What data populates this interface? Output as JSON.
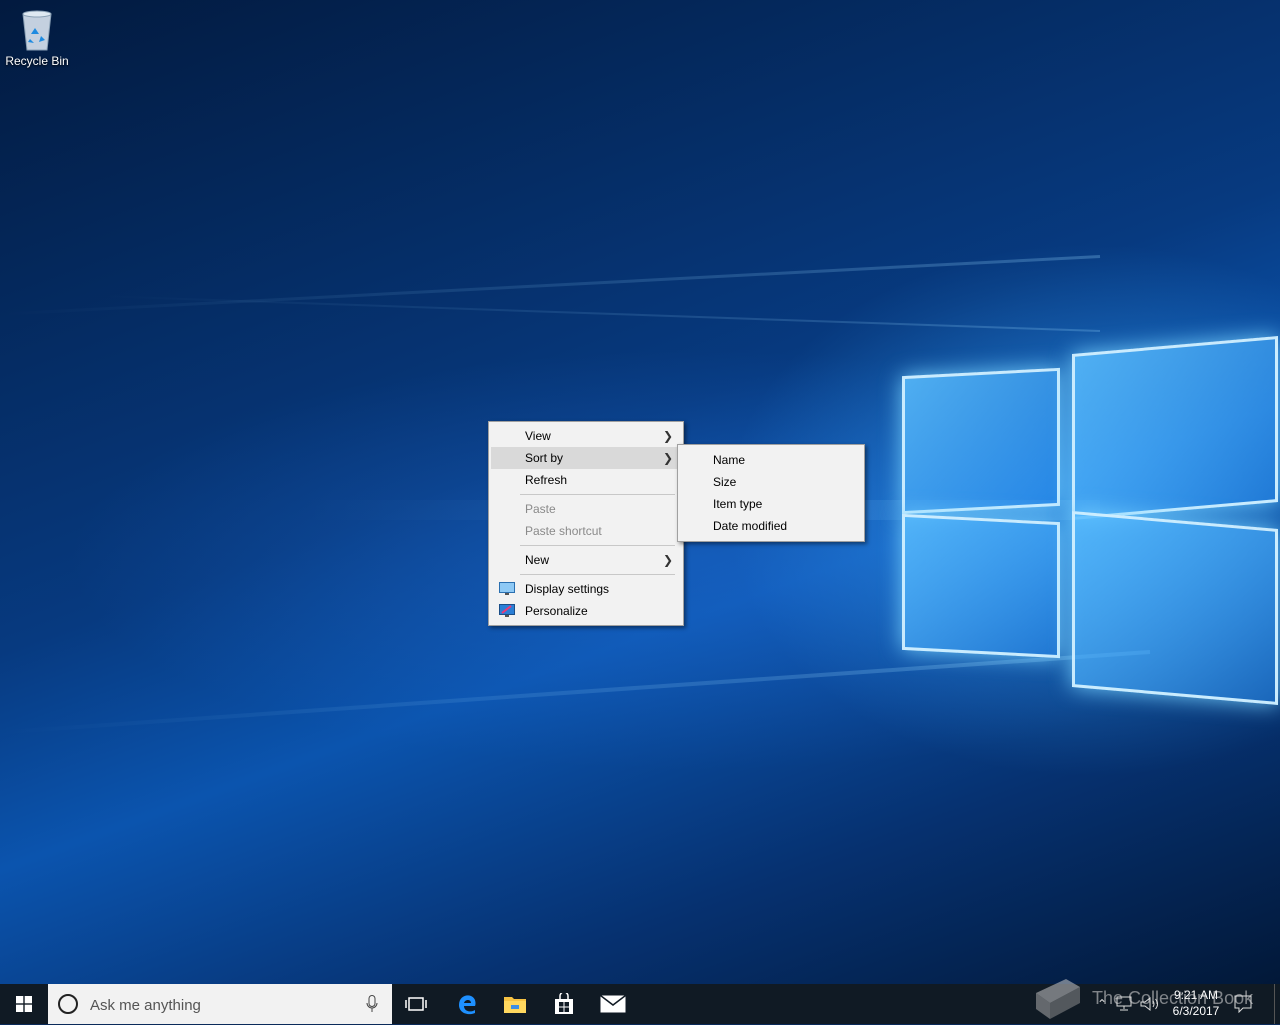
{
  "desktop": {
    "icons": [
      {
        "label": "Recycle Bin",
        "icon": "recycle-bin-icon"
      }
    ]
  },
  "context_menu": {
    "items": [
      {
        "label": "View",
        "has_submenu": true
      },
      {
        "label": "Sort by",
        "has_submenu": true,
        "highlighted": true
      },
      {
        "label": "Refresh"
      },
      {
        "label": "Paste",
        "disabled": true
      },
      {
        "label": "Paste shortcut",
        "disabled": true
      },
      {
        "label": "New",
        "has_submenu": true
      },
      {
        "label": "Display settings",
        "icon": "display-settings-icon"
      },
      {
        "label": "Personalize",
        "icon": "personalize-icon"
      }
    ]
  },
  "sort_submenu": {
    "items": [
      {
        "label": "Name"
      },
      {
        "label": "Size"
      },
      {
        "label": "Item type"
      },
      {
        "label": "Date modified"
      }
    ]
  },
  "taskbar": {
    "search_placeholder": "Ask me anything",
    "pinned": [
      "task-view-icon",
      "edge-icon",
      "file-explorer-icon",
      "store-icon",
      "mail-icon"
    ],
    "clock": {
      "time": "9:21 AM",
      "date": "6/3/2017"
    }
  },
  "watermark": {
    "text": "The Collection Book"
  },
  "colors": {
    "taskbar": "#101a24",
    "menu_bg": "#f2f2f2",
    "menu_highlight": "#d9d9d9",
    "accent": "#0078d7"
  }
}
